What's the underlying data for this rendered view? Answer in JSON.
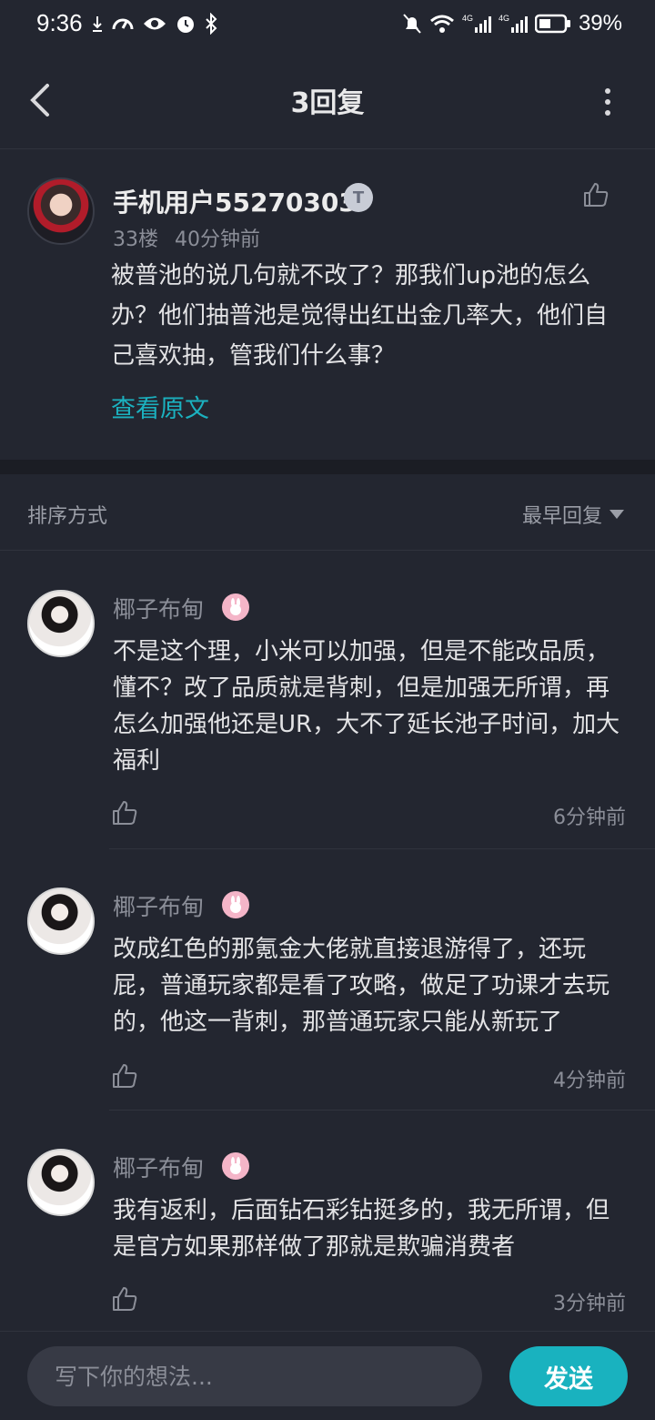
{
  "status_bar": {
    "time": "9:36",
    "battery": "39%",
    "network_1": "4G",
    "network_2": "4G"
  },
  "header": {
    "title": "3回复"
  },
  "main_comment": {
    "username": "手机用户55270303",
    "badge": "T",
    "floor": "33楼",
    "time": "40分钟前",
    "text": "被普池的说几句就不改了？那我们up池的怎么办？他们抽普池是觉得出红出金几率大，他们自己喜欢抽，管我们什么事？",
    "view_original": "查看原文"
  },
  "sort": {
    "label": "排序方式",
    "selected": "最早回复"
  },
  "replies": [
    {
      "username": "椰子布甸",
      "text": "不是这个理，小米可以加强，但是不能改品质，懂不？改了品质就是背刺，但是加强无所谓，再怎么加强他还是UR，大不了延长池子时间，加大福利",
      "time": "6分钟前"
    },
    {
      "username": "椰子布甸",
      "text": "改成红色的那氪金大佬就直接退游得了，还玩屁，普通玩家都是看了攻略，做足了功课才去玩的，他这一背刺，那普通玩家只能从新玩了",
      "time": "4分钟前"
    },
    {
      "username": "椰子布甸",
      "text": "我有返利，后面钻石彩钻挺多的，我无所谓，但是官方如果那样做了那就是欺骗消费者",
      "time": "3分钟前"
    }
  ],
  "bottom_bar": {
    "placeholder": "写下你的想法...",
    "send_label": "发送"
  },
  "colors": {
    "background": "#232630",
    "accent": "#19b2bf",
    "secondary_text": "#8b8e98"
  }
}
